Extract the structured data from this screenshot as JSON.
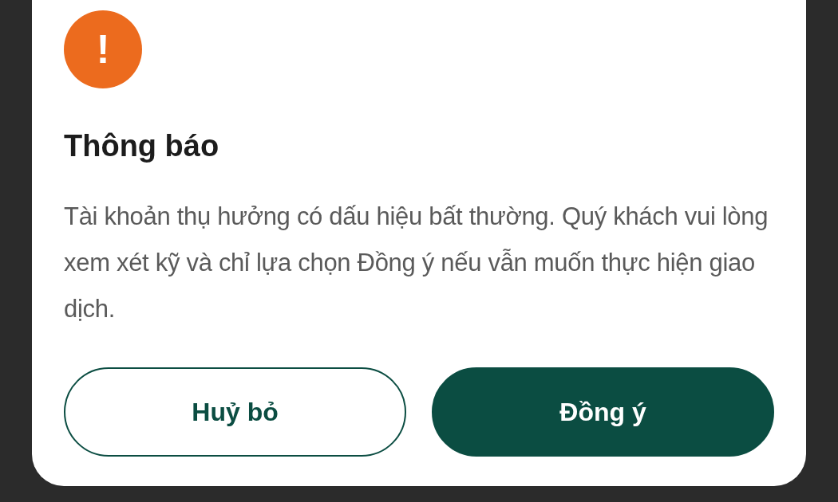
{
  "dialog": {
    "icon": "!",
    "title": "Thông báo",
    "message": "Tài khoản thụ hưởng có dấu hiệu bất thường. Quý khách vui lòng xem xét kỹ và chỉ lựa chọn Đồng ý nếu vẫn muốn thực hiện giao dịch.",
    "buttons": [
      {
        "label": "Huỷ bỏ",
        "kind": "outline"
      },
      {
        "label": "Đồng ý",
        "kind": "filled"
      }
    ]
  }
}
